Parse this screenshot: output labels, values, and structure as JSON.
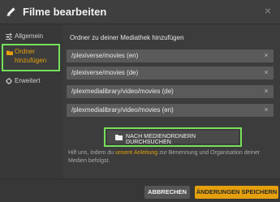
{
  "header": {
    "title": "Filme bearbeiten",
    "close_symbol": "×",
    "edit_icon": "pencil-icon",
    "close_icon": "close-icon"
  },
  "sidebar": {
    "items": [
      {
        "label": "Allgemein",
        "icon": "sliders-icon",
        "active": false
      },
      {
        "label": "Ordner hinzufügen",
        "icon": "folder-icon",
        "active": true
      },
      {
        "label": "Erweitert",
        "icon": "gear-icon",
        "active": false
      }
    ]
  },
  "main": {
    "section_label": "Ordner zu deiner Mediathek hinzufügen",
    "paths": [
      {
        "value": "/plexiverse/movies (en)",
        "remove": "×"
      },
      {
        "value": "/plexiverse/movies (de)",
        "remove": "×"
      },
      {
        "value": "/plexmedialibrary/video/movies (de)",
        "remove": "×"
      },
      {
        "value": "/plexmedialibrary/video/movies (en)",
        "remove": "×"
      }
    ],
    "scan_button_label": "NACH MEDIENORDNERN DURCHSUCHEN",
    "help": {
      "before": "Hilf uns, indem du ",
      "link": "unsere Anleitung",
      "after": " zur Benennung und Organisation deiner Medien befolgst."
    }
  },
  "footer": {
    "cancel_label": "ABBRECHEN",
    "save_label": "ÄNDERUNGEN SPEICHERN"
  },
  "colors": {
    "accent": "#e5a00d",
    "highlight": "#76e05a",
    "background": "#3c3c3c"
  }
}
